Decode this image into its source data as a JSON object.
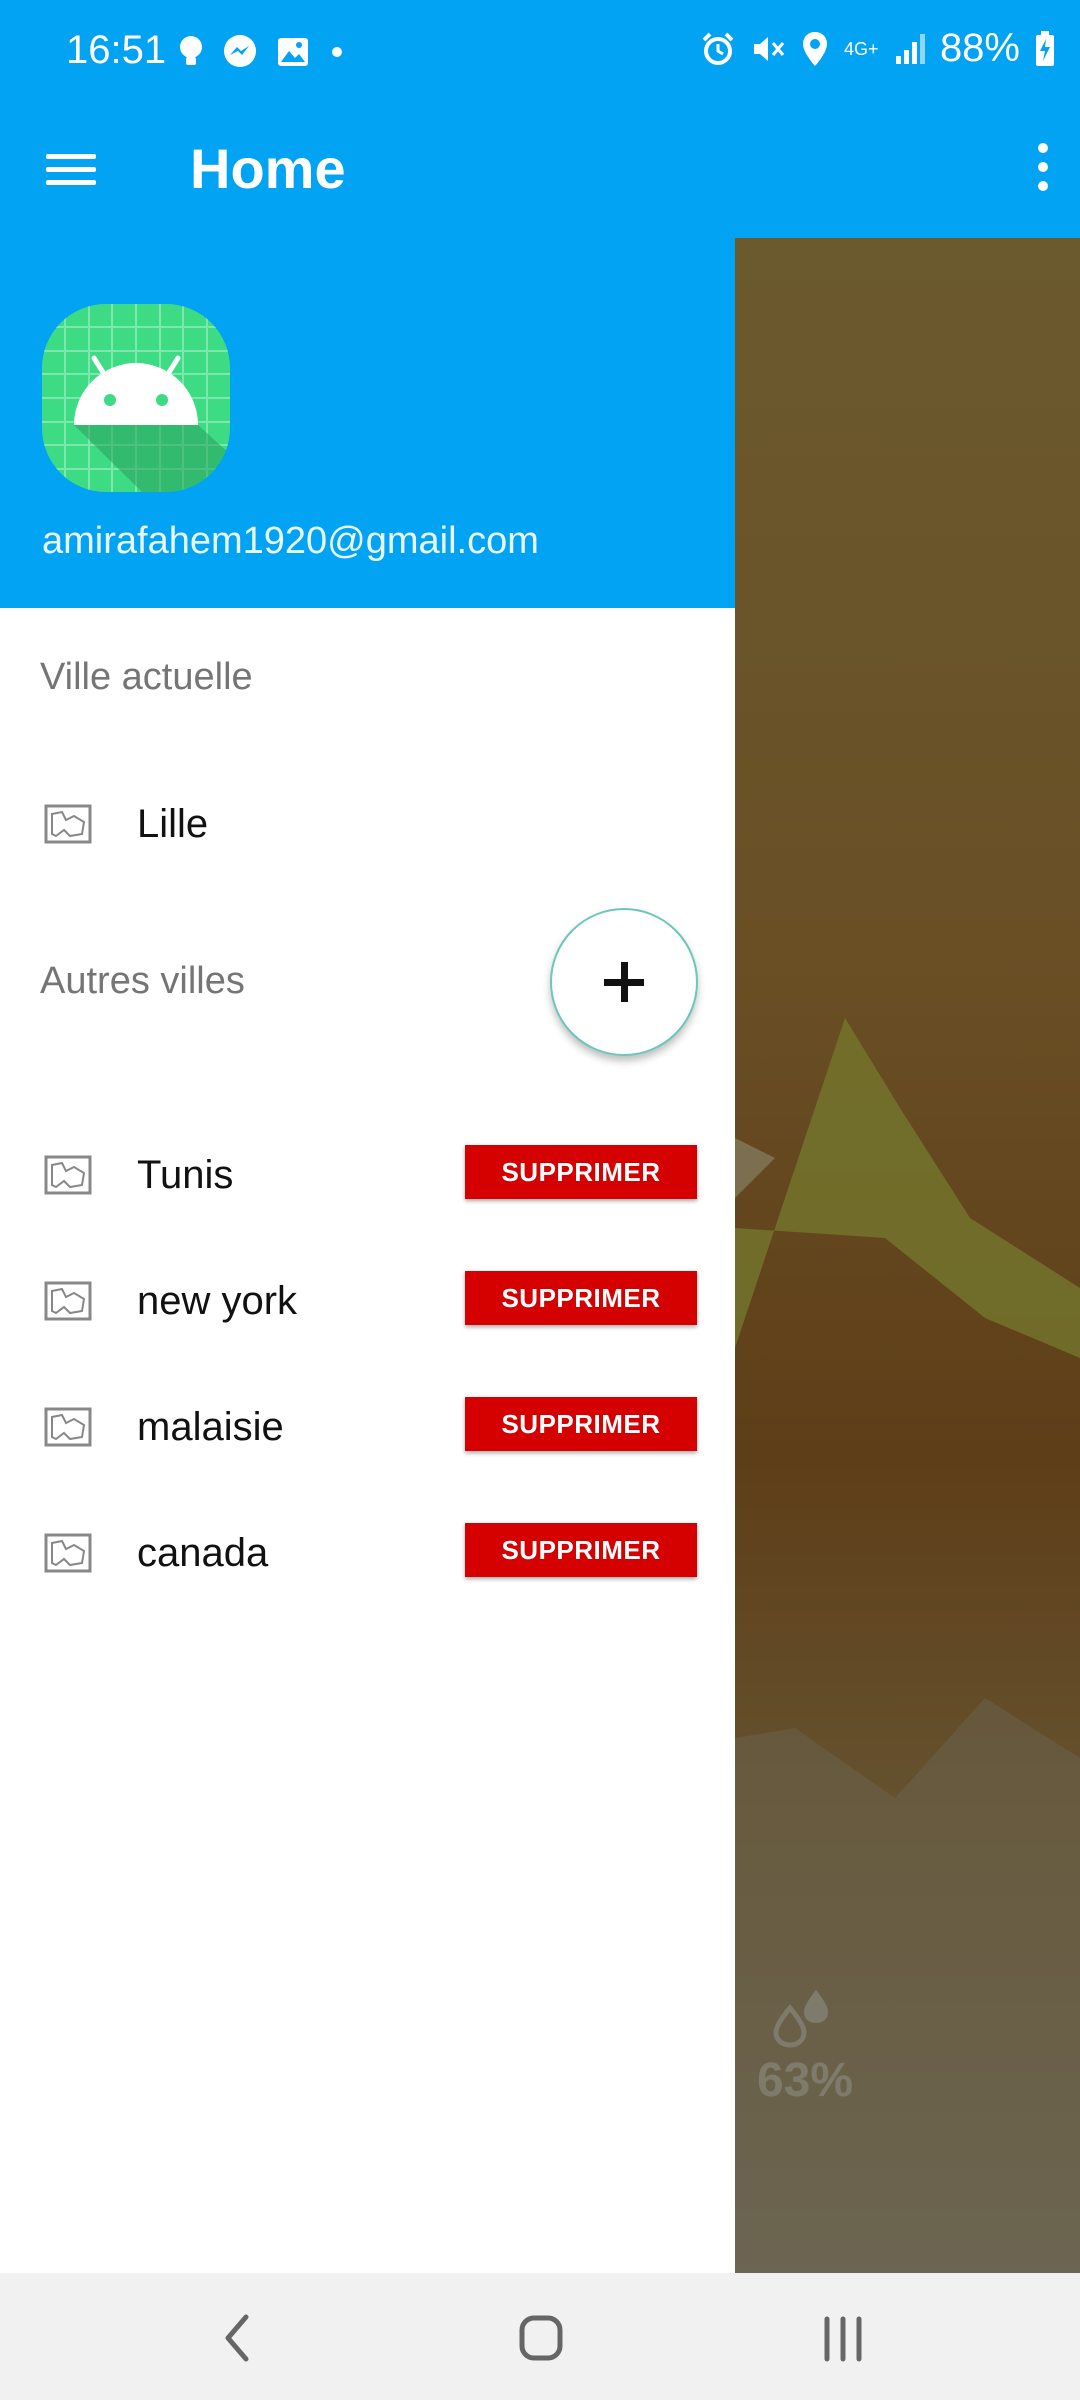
{
  "status_bar": {
    "time": "16:51",
    "battery_percent": "88%",
    "network": "4G+",
    "left_icons": [
      "bulb-icon",
      "messenger-icon",
      "gallery-icon",
      "dot-icon"
    ],
    "right_icons": [
      "alarm-icon",
      "mute-icon",
      "location-icon",
      "network-4g-icon",
      "signal-icon",
      "battery-charging-icon"
    ]
  },
  "app_bar": {
    "title": "Home",
    "menu_icon": "hamburger-menu-icon",
    "more_icon": "more-vert-icon"
  },
  "drawer": {
    "header": {
      "avatar_icon": "android-icon",
      "email": "amirafahem1920@gmail.com",
      "background": "#03A3F4"
    },
    "current_city": {
      "label": "Ville actuelle",
      "name": "Lille",
      "icon": "map-icon"
    },
    "other_cities": {
      "label": "Autres villes",
      "add_icon": "plus-icon",
      "delete_label": "SUPPRIMER",
      "items": [
        {
          "name": "Tunis"
        },
        {
          "name": "new york"
        },
        {
          "name": "malaisie"
        },
        {
          "name": "canada"
        }
      ]
    }
  },
  "background_content": {
    "humidity_icon": "humidity-drops-icon",
    "humidity_value": "63%"
  },
  "colors": {
    "primary": "#03A3F4",
    "delete_button": "#D50000",
    "fab_border": "#6cc7bb"
  },
  "nav_bar": {
    "back_icon": "back-icon",
    "home_icon": "home-icon",
    "recents_icon": "recents-icon"
  }
}
